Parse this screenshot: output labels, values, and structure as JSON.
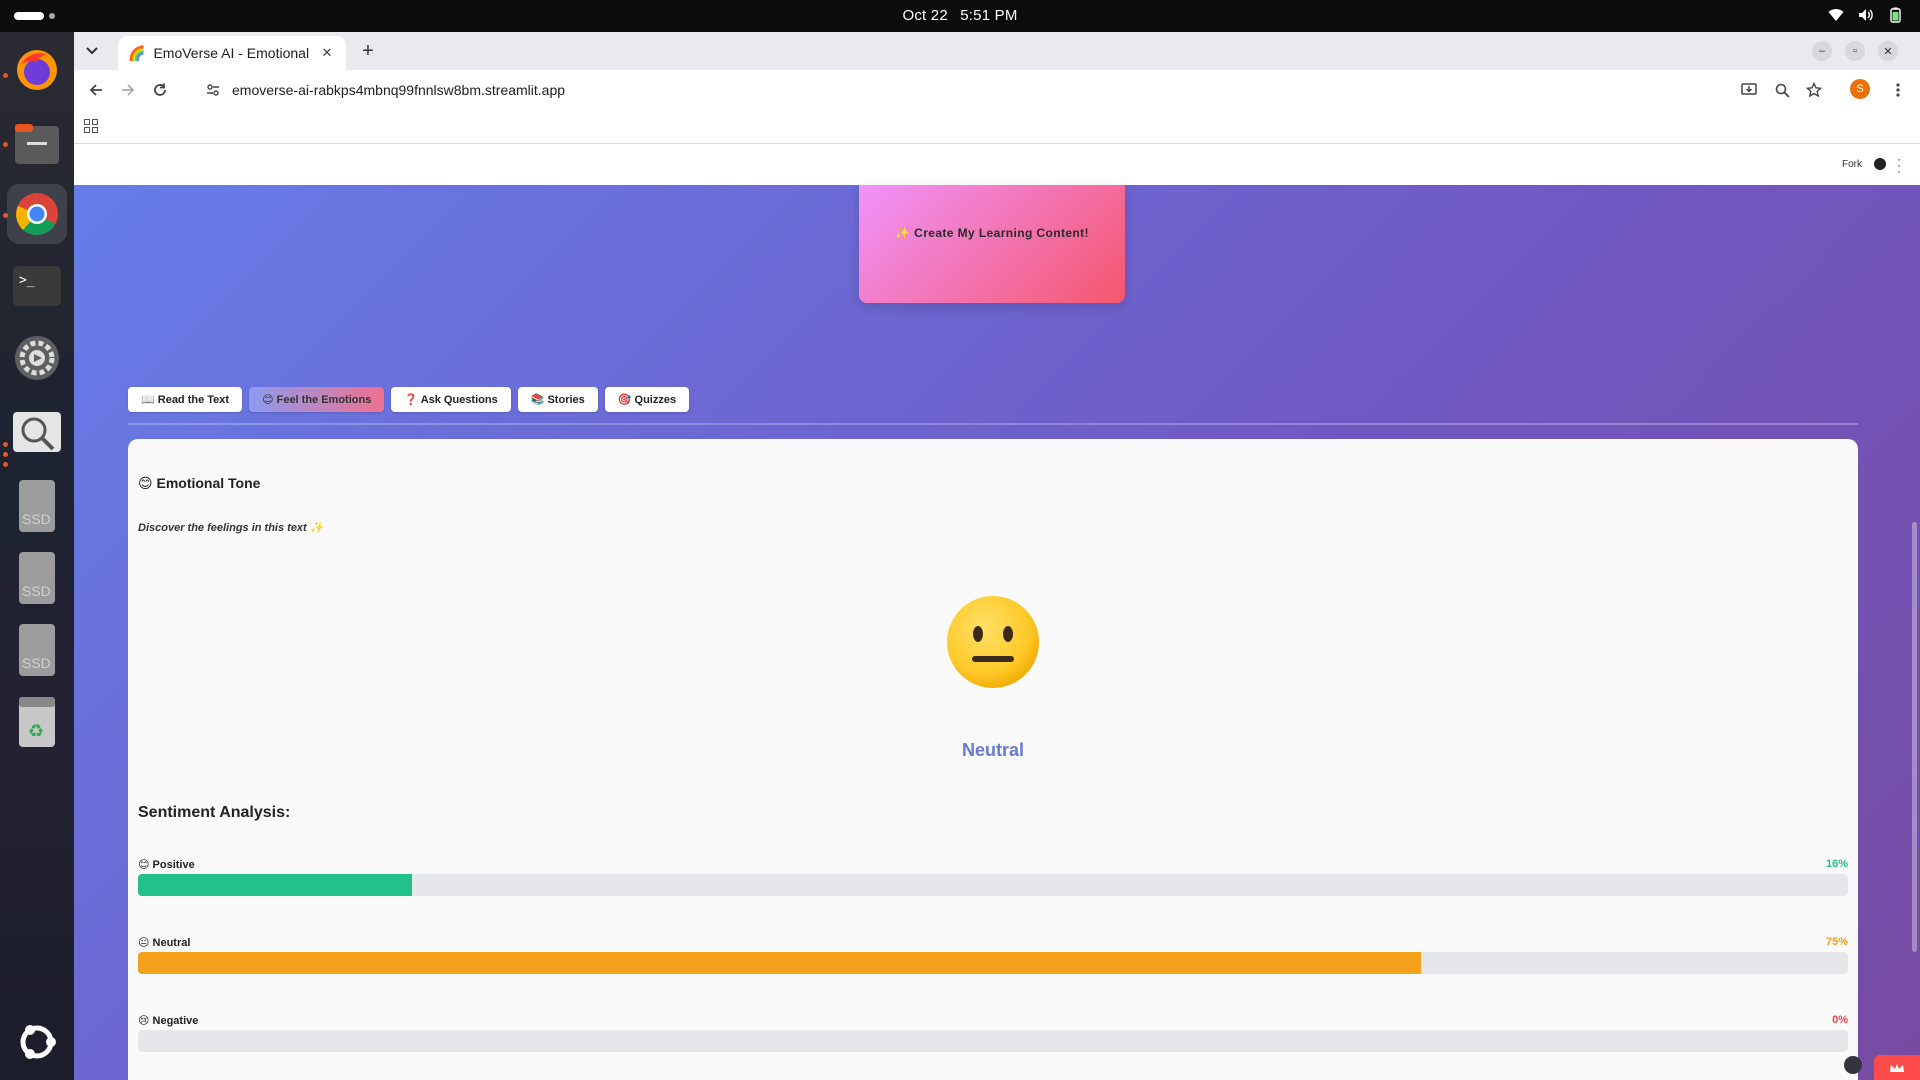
{
  "system": {
    "date": "Oct 22",
    "time": "5:51 PM"
  },
  "dock": {
    "apps": [
      "Firefox",
      "Files",
      "Chrome",
      "Terminal",
      "Settings",
      "Search",
      "SSD",
      "SSD",
      "SSD",
      "Trash",
      "Ubuntu"
    ]
  },
  "browser": {
    "tab_title": "EmoVerse AI - Emotional",
    "tab_favicon": "🌈",
    "url": "emoverse-ai-rabkps4mbnq99fnnlsw8bm.streamlit.app",
    "profile_initial": "S"
  },
  "streamlit": {
    "fork_label": "Fork"
  },
  "page": {
    "create_button": "✨ Create My Learning Content!",
    "tabs": [
      {
        "label": "📖 Read the Text",
        "active": false
      },
      {
        "label": "😊 Feel the Emotions",
        "active": true
      },
      {
        "label": "❓ Ask Questions",
        "active": false
      },
      {
        "label": "📚 Stories",
        "active": false
      },
      {
        "label": "🎯 Quizzes",
        "active": false
      }
    ],
    "emotional_tone": {
      "heading": "😊 Emotional Tone",
      "subtitle": "Discover the feelings in this text ✨",
      "emoji": "😐",
      "label": "Neutral"
    },
    "sentiment": {
      "heading": "Sentiment Analysis:",
      "rows": [
        {
          "label": "😊 Positive",
          "percent_text": "16%",
          "value": 16,
          "color": "#22c08a"
        },
        {
          "label": "😐 Neutral",
          "percent_text": "75%",
          "value": 75,
          "color": "#f5a01a"
        },
        {
          "label": "😢 Negative",
          "percent_text": "0%",
          "value": 0,
          "color": "#ef4444"
        }
      ]
    }
  },
  "colors": {
    "page_gradient_start": "#667eea",
    "page_gradient_end": "#764ba2",
    "button_gradient_start": "#f093fb",
    "button_gradient_end": "#f5576c",
    "tone_label": "#6679d6"
  }
}
